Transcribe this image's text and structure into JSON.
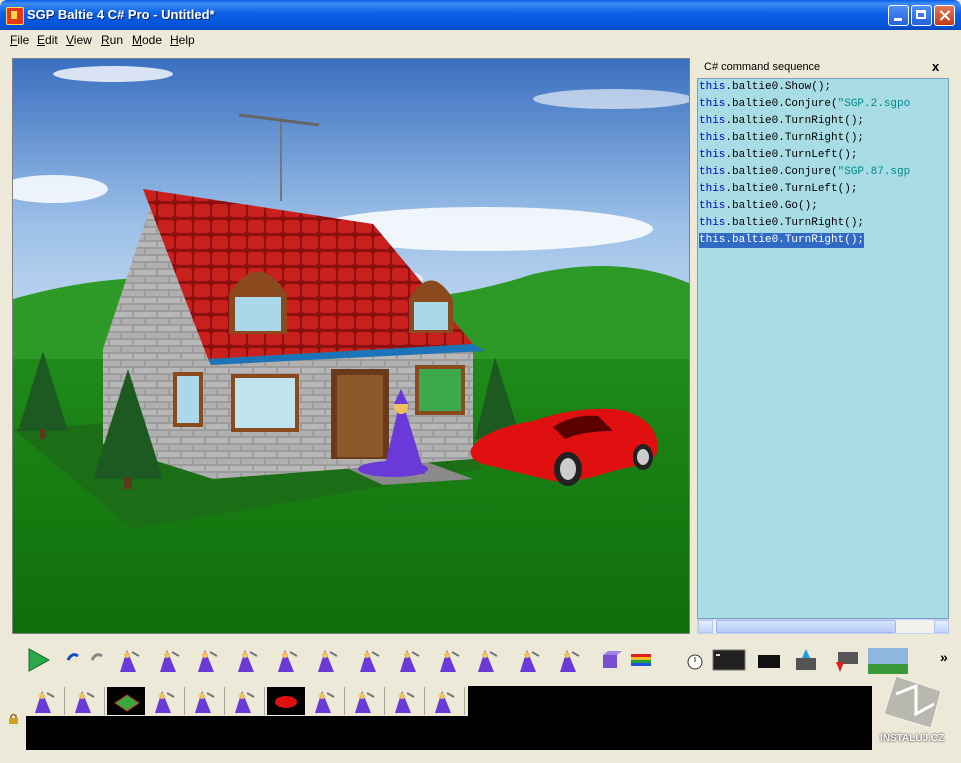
{
  "window": {
    "title": "SGP Baltie 4 C# Pro - Untitled*"
  },
  "menu": [
    "File",
    "Edit",
    "View",
    "Run",
    "Mode",
    "Help"
  ],
  "command_panel": {
    "title": "C# command sequence",
    "close_label": "x",
    "lines": [
      {
        "kw": "this",
        "rest": ".baltie0.Show();",
        "str": "",
        "selected": false
      },
      {
        "kw": "this",
        "rest": ".baltie0.Conjure(",
        "str": "\"SGP.2.sgpo",
        "selected": false
      },
      {
        "kw": "this",
        "rest": ".baltie0.TurnRight();",
        "str": "",
        "selected": false
      },
      {
        "kw": "this",
        "rest": ".baltie0.TurnRight();",
        "str": "",
        "selected": false
      },
      {
        "kw": "this",
        "rest": ".baltie0.TurnLeft();",
        "str": "",
        "selected": false
      },
      {
        "kw": "this",
        "rest": ".baltie0.Conjure(",
        "str": "\"SGP.87.sgp",
        "selected": false
      },
      {
        "kw": "this",
        "rest": ".baltie0.TurnLeft();",
        "str": "",
        "selected": false
      },
      {
        "kw": "this",
        "rest": ".baltie0.Go();",
        "str": "",
        "selected": false
      },
      {
        "kw": "this",
        "rest": ".baltie0.TurnRight();",
        "str": "",
        "selected": false
      },
      {
        "kw": "this",
        "rest": ".baltie0.TurnRight();",
        "str": "",
        "selected": true
      }
    ]
  },
  "toolbar": {
    "tools": [
      "run-icon",
      "undo-icon",
      "redo-icon",
      "wizard-run-icon",
      "wizard-step-icon",
      "wizard-go-icon",
      "turn-left-icon",
      "turn-right-icon",
      "jump-up-icon",
      "jump-down-icon",
      "step-back-icon",
      "walk-icon",
      "fast-walk-icon",
      "speech-icon",
      "wizard-fly-icon",
      "cube-icon",
      "rainbow-icon",
      "timer-icon",
      "console-icon",
      "black-box-icon",
      "up-house-icon",
      "down-house-icon",
      "scene-icon"
    ],
    "more_label": "»"
  },
  "timeline": {
    "slots": [
      "wizard-step",
      "wizard-go",
      "conjure-garden",
      "turn-right",
      "turn-right",
      "wizard-fly",
      "conjure-car",
      "turn-left",
      "wizard-go-right",
      "turn-right",
      "turn-right"
    ]
  },
  "watermark": "INSTALUJ.CZ",
  "colors": {
    "title_bar": "#0a5fe6",
    "panel_bg": "#a8dde6",
    "keyword": "#0000cc",
    "string": "#008a8a",
    "selection": "#316ac5"
  }
}
